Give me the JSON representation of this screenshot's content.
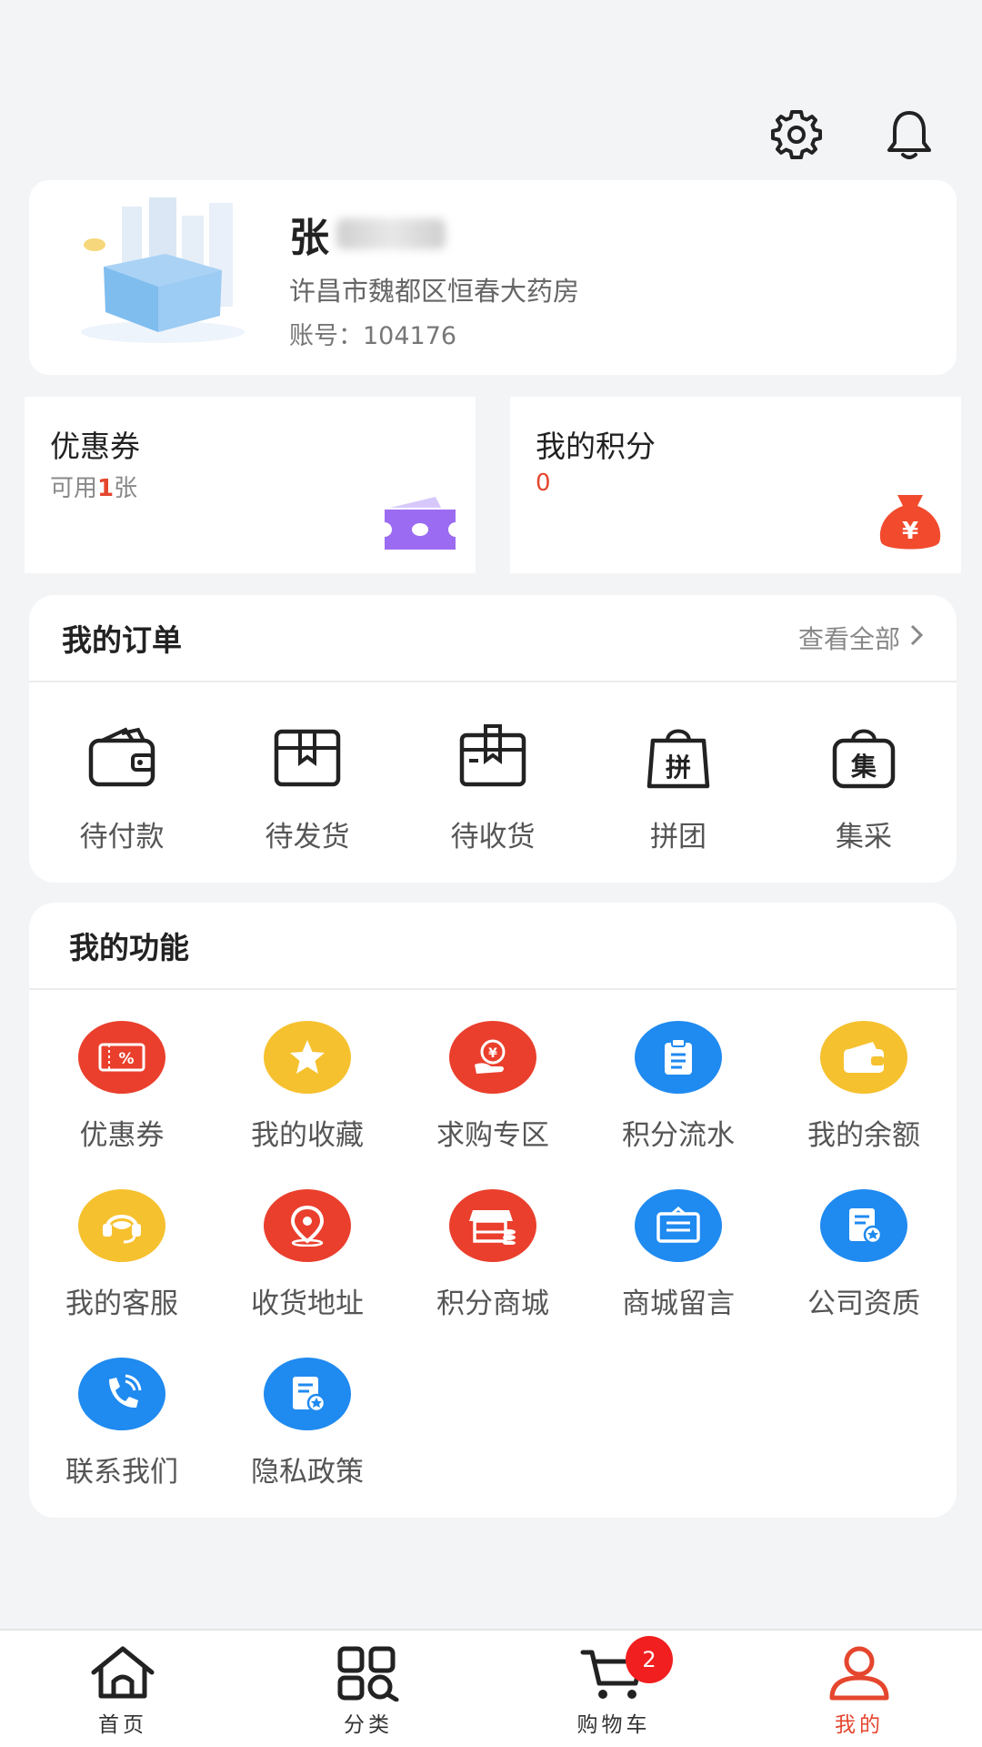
{
  "header": {
    "settings_icon": "gear-icon",
    "notification_icon": "bell-icon"
  },
  "profile": {
    "name_visible": "张",
    "store": "许昌市魏都区恒春大药房",
    "account_label": "账号：",
    "account_number": "104176"
  },
  "coupon_card": {
    "title": "优惠券",
    "prefix": "可用",
    "count": "1",
    "suffix": "张"
  },
  "points_card": {
    "title": "我的积分",
    "value": "0"
  },
  "orders": {
    "title": "我的订单",
    "see_all": "查看全部",
    "items": [
      {
        "label": "待付款",
        "icon": "wallet-icon"
      },
      {
        "label": "待发货",
        "icon": "box-icon"
      },
      {
        "label": "待收货",
        "icon": "package-icon"
      },
      {
        "label": "拼团",
        "icon": "group-buy-bag-icon"
      },
      {
        "label": "集采",
        "icon": "bulk-purchase-bag-icon"
      }
    ]
  },
  "functions": {
    "title": "我的功能",
    "items": [
      {
        "label": "优惠券",
        "icon": "coupon-icon",
        "color": "#ea3f2d"
      },
      {
        "label": "我的收藏",
        "icon": "star-icon",
        "color": "#f6c12f"
      },
      {
        "label": "求购专区",
        "icon": "hand-yen-icon",
        "color": "#ea3f2d"
      },
      {
        "label": "积分流水",
        "icon": "clipboard-icon",
        "color": "#1f8af0"
      },
      {
        "label": "我的余额",
        "icon": "wallet-icon",
        "color": "#f6c12f"
      },
      {
        "label": "我的客服",
        "icon": "headset-icon",
        "color": "#f6c12f"
      },
      {
        "label": "收货地址",
        "icon": "location-pin-icon",
        "color": "#ea3f2d"
      },
      {
        "label": "积分商城",
        "icon": "store-icon",
        "color": "#ea3f2d"
      },
      {
        "label": "商城留言",
        "icon": "message-board-icon",
        "color": "#1f8af0"
      },
      {
        "label": "公司资质",
        "icon": "certificate-icon",
        "color": "#1f8af0"
      },
      {
        "label": "联系我们",
        "icon": "phone-icon",
        "color": "#1f8af0"
      },
      {
        "label": "隐私政策",
        "icon": "document-shield-icon",
        "color": "#1f8af0"
      }
    ]
  },
  "bottom_nav": {
    "items": [
      {
        "label": "首页",
        "icon": "home-icon"
      },
      {
        "label": "分类",
        "icon": "category-grid-icon"
      },
      {
        "label": "购物车",
        "icon": "cart-icon",
        "badge": "2"
      },
      {
        "label": "我的",
        "icon": "user-icon",
        "active": true
      }
    ]
  },
  "colors": {
    "accent": "#e5462e",
    "background": "#f3f4f6",
    "card": "#ffffff"
  }
}
